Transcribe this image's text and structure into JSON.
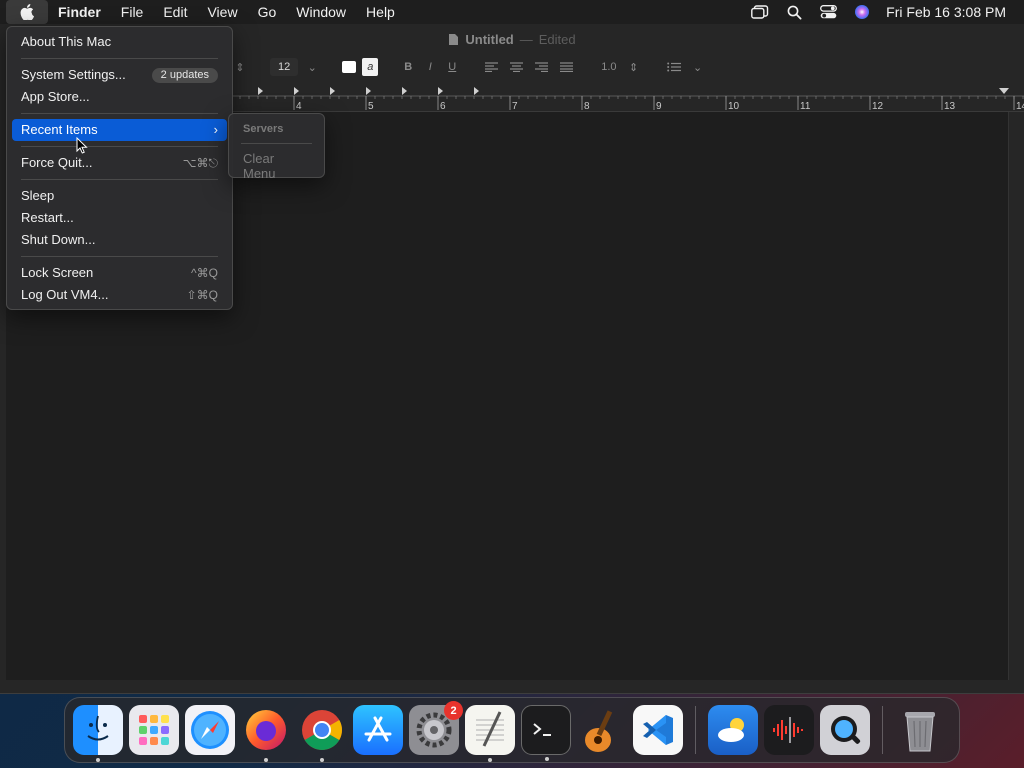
{
  "menubar": {
    "app_name": "Finder",
    "items": [
      "File",
      "Edit",
      "View",
      "Go",
      "Window",
      "Help"
    ],
    "clock": "Fri Feb 16  3:08 PM",
    "status_icons": [
      "stage-manager-icon",
      "search-icon",
      "control-center-icon",
      "siri-icon"
    ]
  },
  "window": {
    "title": "Untitled",
    "title_separator": "—",
    "status": "Edited",
    "toolbar": {
      "font_size": "12",
      "line_spacing": "1.0",
      "style_buttons": [
        "B",
        "I",
        "U"
      ],
      "ruler_numbers": [
        "4",
        "5",
        "6",
        "7",
        "8",
        "9",
        "10",
        "11",
        "12",
        "13",
        "14"
      ]
    }
  },
  "apple_menu": {
    "about": "About This Mac",
    "system_settings": "System Settings...",
    "updates_badge": "2 updates",
    "app_store": "App Store...",
    "recent_items": "Recent Items",
    "force_quit": "Force Quit...",
    "force_quit_shortcut": "⌥⌘⎋",
    "sleep": "Sleep",
    "restart": "Restart...",
    "shut_down": "Shut Down...",
    "lock_screen": "Lock Screen",
    "lock_screen_shortcut": "^⌘Q",
    "log_out": "Log Out VM4...",
    "log_out_shortcut": "⇧⌘Q"
  },
  "recent_submenu": {
    "heading": "Servers",
    "clear": "Clear Menu"
  },
  "dock": {
    "apps": [
      {
        "icon": "finder-icon",
        "running": true
      },
      {
        "icon": "launchpad-icon",
        "running": false
      },
      {
        "icon": "safari-icon",
        "running": false
      },
      {
        "icon": "firefox-icon",
        "running": true
      },
      {
        "icon": "chrome-icon",
        "running": true
      },
      {
        "icon": "app-store-icon",
        "running": false
      },
      {
        "icon": "system-settings-icon",
        "running": false,
        "badge": "2"
      },
      {
        "icon": "textedit-icon",
        "running": true
      },
      {
        "icon": "terminal-icon",
        "running": true
      },
      {
        "icon": "garageband-icon",
        "running": false
      },
      {
        "icon": "vscode-icon",
        "running": false
      },
      {
        "icon": "weather-icon",
        "running": false
      },
      {
        "icon": "voice-memos-icon",
        "running": false
      },
      {
        "icon": "quicktime-icon",
        "running": false
      },
      {
        "icon": "trash-icon",
        "running": false
      }
    ],
    "settings_badge": "2"
  },
  "colors": {
    "accent": "#0a5cd6",
    "menu_bg": "#2c2c2e",
    "badge_red": "#e8332d"
  }
}
